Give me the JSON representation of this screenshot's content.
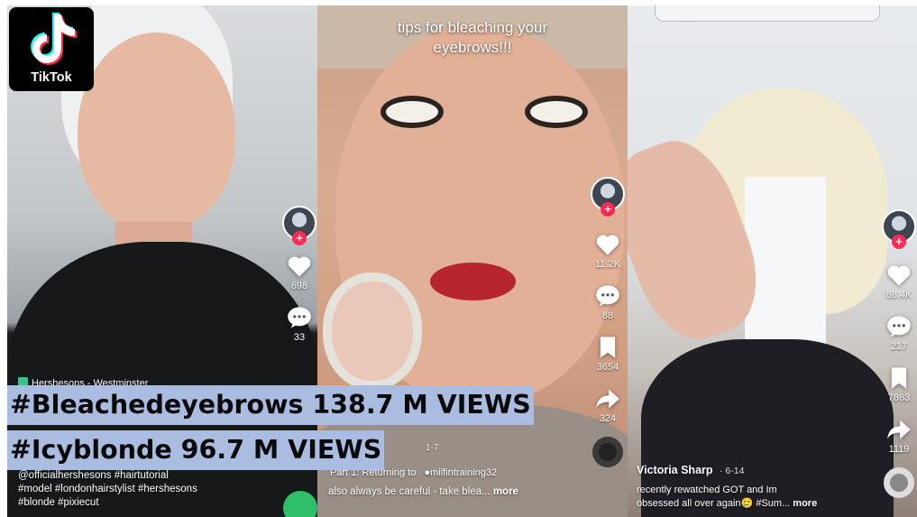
{
  "logo": {
    "wordmark": "TikTok",
    "icon": "tiktok-note-icon"
  },
  "overlay": {
    "line1": "#Bleachedeyebrows 138.7 M VIEWS",
    "line2": "#Icyblonde 96.7 M VIEWS",
    "background_color": "#aabce0"
  },
  "videos": [
    {
      "location_tag": "Hershesons - Westminster",
      "caption_lines": [
        "@officialhershesons #hairtutorial",
        "#model #londonhairstylist #hershesons",
        "#blonde #pixiecut"
      ],
      "likes": "698",
      "comments": "33"
    },
    {
      "overlay_title_lines": [
        "tips for bleaching your",
        "eyebrows!!!"
      ],
      "date_partial": "1-7",
      "part_label": "Part 1: Returning to",
      "music_credit": "milfintraining32",
      "caption": "also always be careful - take blea...",
      "more": "more",
      "likes": "11.2K",
      "comments": "88",
      "saves": "3654",
      "shares": "324"
    },
    {
      "author": "Victoria Sharp",
      "date": "· 6-14",
      "caption_line1": "recently rewatched GOT and Im",
      "caption_line2": "obsessed all over again🥲 #Sum...",
      "more": "more",
      "likes": "88.4K",
      "comments": "217",
      "saves": "7863",
      "shares": "1119"
    }
  ],
  "colors": {
    "follow_plus": "#fe2c55",
    "tiktok_cyan": "#25f4ee",
    "tiktok_red": "#fe2c55"
  }
}
